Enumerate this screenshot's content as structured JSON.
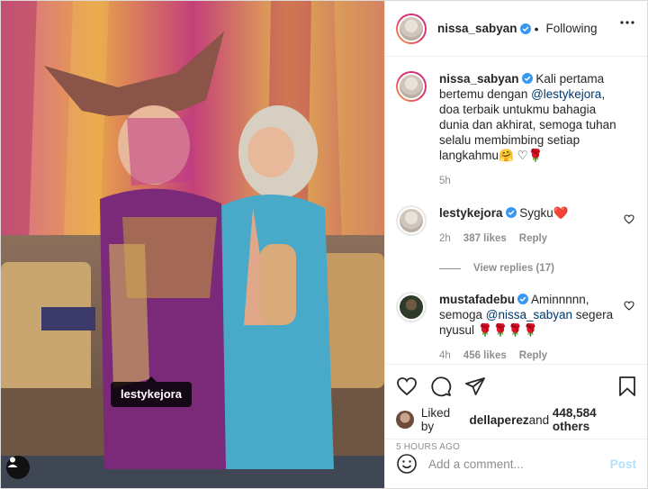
{
  "post": {
    "author": "nissa_sabyan",
    "follow_status": "Following",
    "dot": "•",
    "photo_tag": "lestykejora"
  },
  "caption": {
    "username": "nissa_sabyan",
    "text_before": " Kali pertama bertemu dengan ",
    "mention": "@lestykejora",
    "text_after": ", doa terbaik untukmu bahagia dunia dan akhirat, semoga tuhan selalu membimbing setiap langkahmu🤗 ♡🌹",
    "time": "5h"
  },
  "comments": [
    {
      "username": "lestykejora",
      "text": " Sygku❤️",
      "time": "2h",
      "likes": "387 likes",
      "reply": "Reply",
      "view_replies": "View replies (17)"
    },
    {
      "username": "mustafadebu",
      "text_before": " Aminnnnn, semoga ",
      "mention": "@nissa_sabyan",
      "text_after": " segera nyusul 🌹🌹🌹🌹",
      "time": "4h",
      "likes": "456 likes",
      "reply": "Reply"
    }
  ],
  "liked_by": {
    "prefix": "Liked by ",
    "user": "dellaperez",
    "middle": " and ",
    "others": "448,584 others"
  },
  "timestamp": "5 HOURS AGO",
  "composer": {
    "placeholder": "Add a comment...",
    "post_label": "Post"
  },
  "icons": {
    "like": "heart-icon",
    "comment": "comment-icon",
    "share": "share-icon",
    "save": "bookmark-icon",
    "emoji": "emoji-icon",
    "more": "more-options-icon",
    "verified": "verified-badge-icon",
    "tagged_users": "user-tag-icon"
  },
  "colors": {
    "link": "#00376b",
    "verified": "#3897f0",
    "post_button_disabled": "#b2dffc",
    "meta_text": "#8e8e8e"
  }
}
